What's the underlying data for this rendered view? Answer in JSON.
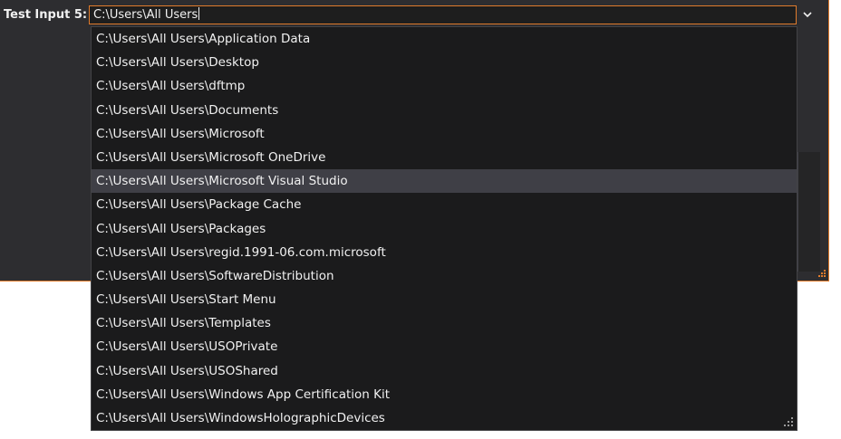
{
  "field": {
    "label": "Test Input 5:",
    "value": "C:\\Users\\All Users"
  },
  "dropdown": {
    "icon": "chevron-down-icon"
  },
  "suggestions": [
    "C:\\Users\\All Users\\Application Data",
    "C:\\Users\\All Users\\Desktop",
    "C:\\Users\\All Users\\dftmp",
    "C:\\Users\\All Users\\Documents",
    "C:\\Users\\All Users\\Microsoft",
    "C:\\Users\\All Users\\Microsoft OneDrive",
    "C:\\Users\\All Users\\Microsoft Visual Studio",
    "C:\\Users\\All Users\\Package Cache",
    "C:\\Users\\All Users\\Packages",
    "C:\\Users\\All Users\\regid.1991-06.com.microsoft",
    "C:\\Users\\All Users\\SoftwareDistribution",
    "C:\\Users\\All Users\\Start Menu",
    "C:\\Users\\All Users\\Templates",
    "C:\\Users\\All Users\\USOPrivate",
    "C:\\Users\\All Users\\USOShared",
    "C:\\Users\\All Users\\Windows App Certification Kit",
    "C:\\Users\\All Users\\WindowsHolographicDevices"
  ],
  "hovered_index": 6,
  "colors": {
    "accent": "#e07b2c",
    "background": "#2d2d30",
    "list_background": "#1b1b1c",
    "hover": "#3f3f46",
    "text": "#f1f1f1"
  }
}
